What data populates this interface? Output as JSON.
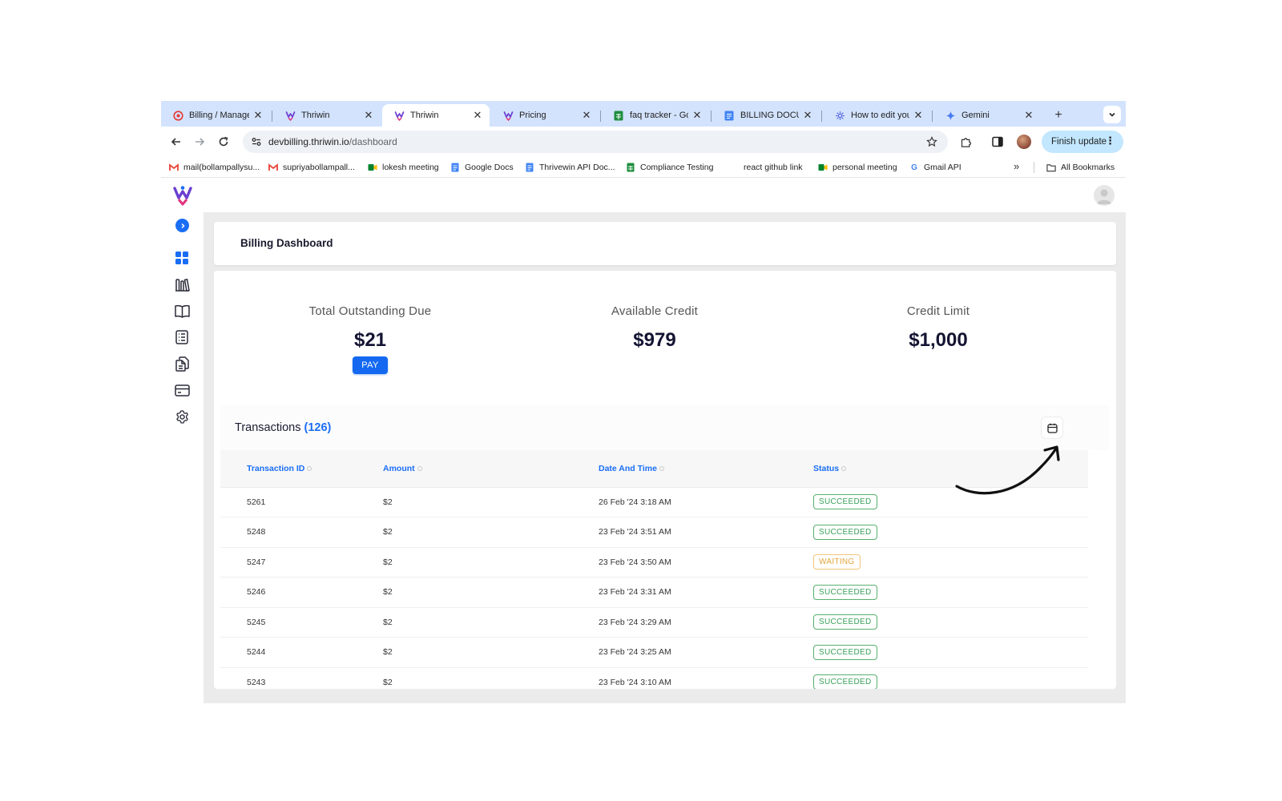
{
  "browser": {
    "tabs": [
      {
        "title": "Billing / Manage",
        "icon": "billing-favicon"
      },
      {
        "title": "Thriwin",
        "icon": "thriwin-favicon"
      },
      {
        "title": "Thriwin",
        "icon": "thriwin-favicon",
        "active": true
      },
      {
        "title": "Pricing",
        "icon": "thriwin-favicon"
      },
      {
        "title": "faq tracker - Go",
        "icon": "sheets-favicon"
      },
      {
        "title": "BILLING DOCUM",
        "icon": "docs-favicon"
      },
      {
        "title": "How to edit your",
        "icon": "gear-favicon"
      },
      {
        "title": "Gemini",
        "icon": "gemini-favicon"
      }
    ],
    "new_tab_label": "+",
    "url": {
      "host": "devbilling.thriwin.io",
      "path": "/dashboard"
    },
    "finish_update_label": "Finish update",
    "bookmarks": [
      {
        "label": "mail(bollampallysu...",
        "icon": "gmail-icon"
      },
      {
        "label": "supriyabollampall...",
        "icon": "gmail-icon"
      },
      {
        "label": "lokesh meeting",
        "icon": "meet-icon"
      },
      {
        "label": "Google Docs",
        "icon": "docs-icon"
      },
      {
        "label": "Thrivewin API Doc...",
        "icon": "docs-icon"
      },
      {
        "label": "Compliance Testing",
        "icon": "sheets-icon"
      },
      {
        "label": "react github link",
        "icon": "none"
      },
      {
        "label": "personal meeting",
        "icon": "meet-icon"
      },
      {
        "label": "Gmail API",
        "icon": "google-icon"
      }
    ],
    "bookmarks_overflow_label": "»",
    "all_bookmarks_label": "All Bookmarks"
  },
  "page": {
    "title": "Billing Dashboard",
    "stats": [
      {
        "label": "Total Outstanding Due",
        "value": "$21"
      },
      {
        "label": "Available Credit",
        "value": "$979"
      },
      {
        "label": "Credit Limit",
        "value": "$1,000"
      }
    ],
    "pay_label": "PAY",
    "transactions": {
      "title": "Transactions",
      "count": "(126)",
      "columns": [
        "Transaction ID",
        "Amount",
        "Date And Time",
        "Status"
      ],
      "rows": [
        {
          "id": "5261",
          "amount": "$2",
          "date": "26 Feb '24 3:18 AM",
          "status": "SUCCEEDED"
        },
        {
          "id": "5248",
          "amount": "$2",
          "date": "23 Feb '24 3:51 AM",
          "status": "SUCCEEDED"
        },
        {
          "id": "5247",
          "amount": "$2",
          "date": "23 Feb '24 3:50 AM",
          "status": "WAITING"
        },
        {
          "id": "5246",
          "amount": "$2",
          "date": "23 Feb '24 3:31 AM",
          "status": "SUCCEEDED"
        },
        {
          "id": "5245",
          "amount": "$2",
          "date": "23 Feb '24 3:29 AM",
          "status": "SUCCEEDED"
        },
        {
          "id": "5244",
          "amount": "$2",
          "date": "23 Feb '24 3:25 AM",
          "status": "SUCCEEDED"
        },
        {
          "id": "5243",
          "amount": "$2",
          "date": "23 Feb '24 3:10 AM",
          "status": "SUCCEEDED"
        }
      ]
    }
  },
  "colors": {
    "accent": "#1a6ef5",
    "succeeded": "#39a05a",
    "waiting": "#e3a53b",
    "tabstrip": "#d3e3fd"
  }
}
